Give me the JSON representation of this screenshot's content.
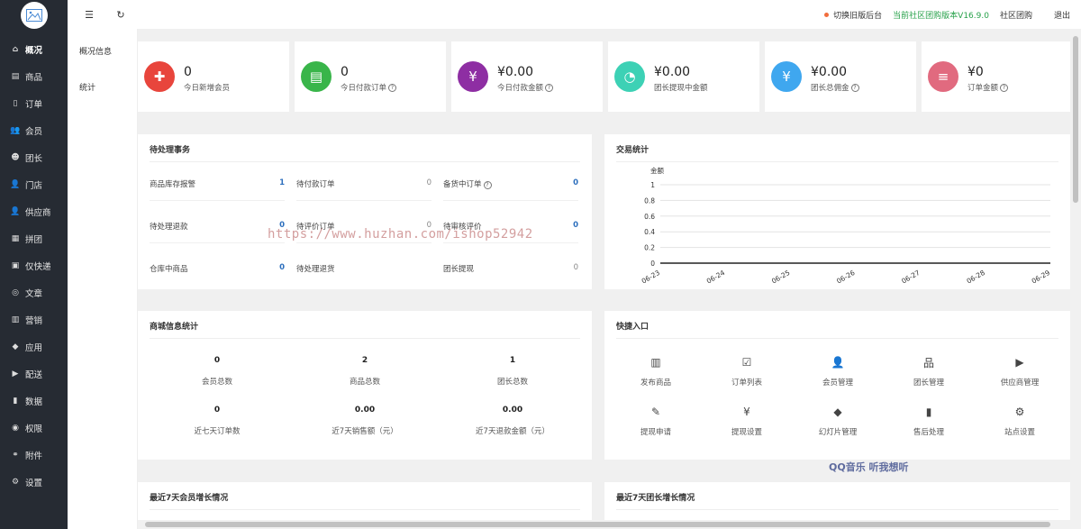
{
  "sidebar": {
    "items": [
      {
        "label": "概况",
        "icon": "home-icon",
        "glyph": "⌂",
        "active": true
      },
      {
        "label": "商品",
        "icon": "goods-icon",
        "glyph": "▤"
      },
      {
        "label": "订单",
        "icon": "order-icon",
        "glyph": "▯"
      },
      {
        "label": "会员",
        "icon": "members-icon",
        "glyph": "👥"
      },
      {
        "label": "团长",
        "icon": "leader-icon",
        "glyph": "☻"
      },
      {
        "label": "门店",
        "icon": "store-icon",
        "glyph": "👤"
      },
      {
        "label": "供应商",
        "icon": "supplier-icon",
        "glyph": "👤"
      },
      {
        "label": "拼团",
        "icon": "groupbuy-icon",
        "glyph": "▦"
      },
      {
        "label": "仅快递",
        "icon": "express-icon",
        "glyph": "▣"
      },
      {
        "label": "文章",
        "icon": "article-icon",
        "glyph": "◎"
      },
      {
        "label": "营销",
        "icon": "marketing-icon",
        "glyph": "▥"
      },
      {
        "label": "应用",
        "icon": "apps-icon",
        "glyph": "◆"
      },
      {
        "label": "配送",
        "icon": "delivery-icon",
        "glyph": "▶"
      },
      {
        "label": "数据",
        "icon": "data-icon",
        "glyph": "▮"
      },
      {
        "label": "权限",
        "icon": "permission-icon",
        "glyph": "◉"
      },
      {
        "label": "附件",
        "icon": "attachment-icon",
        "glyph": "⚭"
      },
      {
        "label": "设置",
        "icon": "settings-icon",
        "glyph": "⚙"
      }
    ]
  },
  "topbar": {
    "switch_label": "切换旧版后台",
    "version_label": "当前社区团购版本V16.9.0",
    "community_label": "社区团购",
    "logout_label": "退出"
  },
  "submenu": {
    "items": [
      "概况信息",
      "统计"
    ]
  },
  "stats": [
    {
      "value": "0",
      "label": "今日新增会员",
      "color": "#e8453c",
      "glyph": "✚",
      "help": false
    },
    {
      "value": "0",
      "label": "今日付款订单",
      "color": "#39b54a",
      "glyph": "▤",
      "help": true
    },
    {
      "value": "¥0.00",
      "label": "今日付款金额",
      "color": "#8e2ea3",
      "glyph": "¥",
      "help": true
    },
    {
      "value": "¥0.00",
      "label": "团长提现中金额",
      "color": "#3dd1b5",
      "glyph": "◔",
      "help": false
    },
    {
      "value": "¥0.00",
      "label": "团长总佣金",
      "color": "#3fa7ef",
      "glyph": "¥",
      "help": true
    },
    {
      "value": "¥0",
      "label": "订单金额",
      "color": "#e16a7f",
      "glyph": "≡",
      "help": true
    }
  ],
  "todo": {
    "title": "待处理事务",
    "items": [
      {
        "label": "商品库存报警",
        "value": "1",
        "blue": true,
        "help": false
      },
      {
        "label": "待付款订单",
        "value": "0",
        "blue": false,
        "help": false
      },
      {
        "label": "备货中订单",
        "value": "0",
        "blue": true,
        "help": true
      },
      {
        "label": "待处理退款",
        "value": "0",
        "blue": true,
        "help": false
      },
      {
        "label": "待评价订单",
        "value": "0",
        "blue": false,
        "help": false
      },
      {
        "label": "待审核评价",
        "value": "0",
        "blue": true,
        "help": false
      },
      {
        "label": "仓库中商品",
        "value": "0",
        "blue": true,
        "help": false
      },
      {
        "label": "待处理退货",
        "value": "",
        "blue": false,
        "help": false
      },
      {
        "label": "团长提现",
        "value": "0",
        "blue": false,
        "help": false
      }
    ]
  },
  "trade": {
    "title": "交易统计"
  },
  "chart_data": {
    "type": "line",
    "ylabel": "金额",
    "x": [
      "06-23",
      "06-24",
      "06-25",
      "06-26",
      "06-27",
      "06-28",
      "06-29"
    ],
    "series": [
      {
        "values": [
          0,
          0,
          0,
          0,
          0,
          0,
          0
        ]
      }
    ],
    "yticks": [
      "1",
      "0.8",
      "0.6",
      "0.4",
      "0.2",
      "0"
    ],
    "ylim": [
      0,
      1
    ],
    "grid": true
  },
  "shop": {
    "title": "商城信息统计",
    "items": [
      {
        "value": "0",
        "label": "会员总数"
      },
      {
        "value": "2",
        "label": "商品总数"
      },
      {
        "value": "1",
        "label": "团长总数"
      },
      {
        "value": "0",
        "label": "近七天订单数"
      },
      {
        "value": "0.00",
        "label": "近7天销售额（元）"
      },
      {
        "value": "0.00",
        "label": "近7天退款金额（元）"
      }
    ]
  },
  "quick": {
    "title": "快捷入口",
    "items": [
      {
        "label": "发布商品",
        "icon": "barcode-icon",
        "glyph": "▥"
      },
      {
        "label": "订单列表",
        "icon": "clipboard-check-icon",
        "glyph": "☑"
      },
      {
        "label": "会员管理",
        "icon": "member-manage-icon",
        "glyph": "👤"
      },
      {
        "label": "团长管理",
        "icon": "org-tree-icon",
        "glyph": "品"
      },
      {
        "label": "供应商管理",
        "icon": "truck-icon",
        "glyph": "▶"
      },
      {
        "label": "提现申请",
        "icon": "ticket-icon",
        "glyph": "✎"
      },
      {
        "label": "提现设置",
        "icon": "yen-circle-icon",
        "glyph": "¥"
      },
      {
        "label": "幻灯片管理",
        "icon": "tag-icon",
        "glyph": "◆"
      },
      {
        "label": "售后处理",
        "icon": "bar-chart-icon",
        "glyph": "▮"
      },
      {
        "label": "站点设置",
        "icon": "gear-icon",
        "glyph": "⚙"
      }
    ]
  },
  "member_growth": {
    "title": "最近7天会员增长情况"
  },
  "leader_growth": {
    "title": "最近7天团长增长情况"
  },
  "watermark": "https://www.huzhan.com/ishop52942",
  "qq_mark": "QQ音乐 听我想听"
}
